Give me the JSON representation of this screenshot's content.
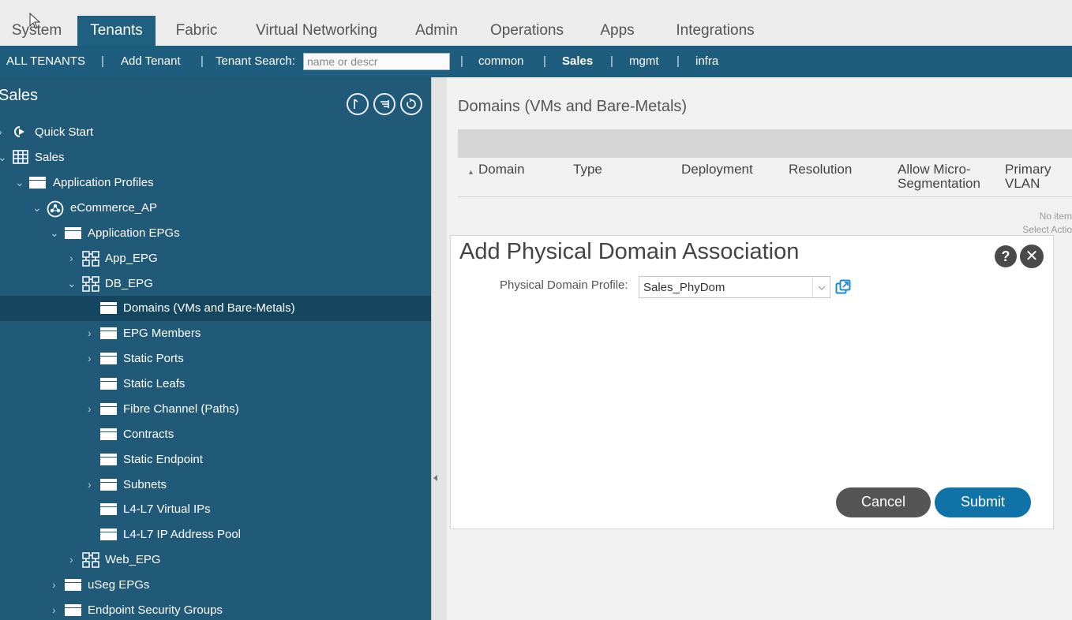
{
  "top_nav": {
    "tabs": [
      {
        "label": "System"
      },
      {
        "label": "Tenants"
      },
      {
        "label": "Fabric"
      },
      {
        "label": "Virtual Networking"
      },
      {
        "label": "Admin"
      },
      {
        "label": "Operations"
      },
      {
        "label": "Apps"
      },
      {
        "label": "Integrations"
      }
    ],
    "active_tab": "Tenants"
  },
  "sub_nav": {
    "all_tenants": "ALL TENANTS",
    "add_tenant": "Add Tenant",
    "search_label": "Tenant Search:",
    "search_placeholder": "name or descr",
    "tenants": [
      "common",
      "Sales",
      "mgmt",
      "infra"
    ],
    "separator": "|"
  },
  "sidebar": {
    "title": "Sales",
    "tree": [
      {
        "label": "Quick Start"
      },
      {
        "label": "Sales"
      },
      {
        "label": "Application Profiles"
      },
      {
        "label": "eCommerce_AP"
      },
      {
        "label": "Application EPGs"
      },
      {
        "label": "App_EPG"
      },
      {
        "label": "DB_EPG"
      },
      {
        "label": "Domains (VMs and Bare-Metals)"
      },
      {
        "label": "EPG Members"
      },
      {
        "label": "Static Ports"
      },
      {
        "label": "Static Leafs"
      },
      {
        "label": "Fibre Channel (Paths)"
      },
      {
        "label": "Contracts"
      },
      {
        "label": "Static Endpoint"
      },
      {
        "label": "Subnets"
      },
      {
        "label": "L4-L7 Virtual IPs"
      },
      {
        "label": "L4-L7 IP Address Pool"
      },
      {
        "label": "Web_EPG"
      },
      {
        "label": "uSeg EPGs"
      },
      {
        "label": "Endpoint Security Groups"
      }
    ]
  },
  "main": {
    "title": "Domains (VMs and Bare-Metals)",
    "columns": [
      "Domain",
      "Type",
      "Deployment",
      "Resolution",
      "Allow Micro-",
      "Segmentation",
      "Primary",
      "VLAN"
    ],
    "empty_line1": "No item",
    "empty_line2": "Select Actio"
  },
  "dialog": {
    "title": "Add Physical Domain Association",
    "help_glyph": "?",
    "close_glyph": "✕",
    "field_label": "Physical Domain Profile:",
    "field_value": "Sales_PhyDom",
    "cancel_label": "Cancel",
    "submit_label": "Submit"
  },
  "colors": {
    "nav_active": "#1f5f80",
    "sidebar_bg": "#215a78",
    "selected_row": "#14465f",
    "submit": "#0f73a8",
    "cancel": "#555555"
  }
}
